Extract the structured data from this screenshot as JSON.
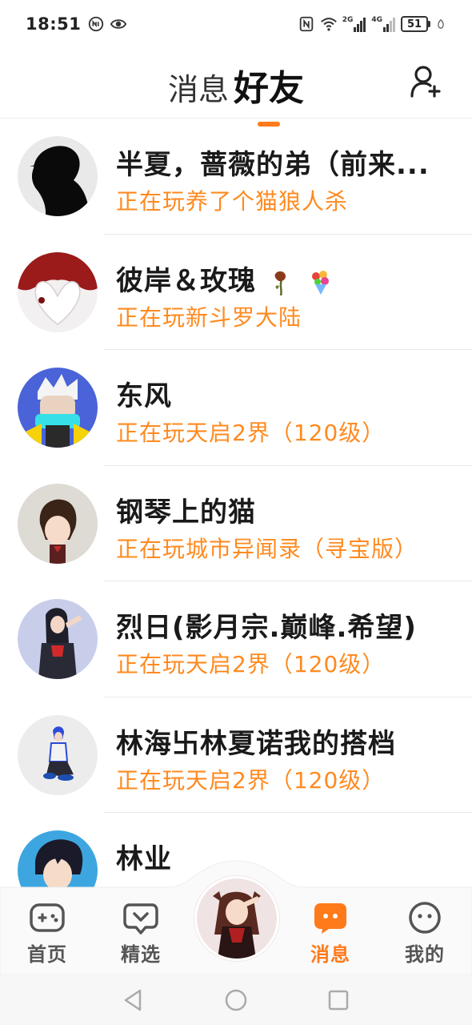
{
  "status_bar": {
    "time": "18:51",
    "network_2g": "2G",
    "network_4g": "4G",
    "battery": "51"
  },
  "header": {
    "tab_messages": "消息",
    "tab_friends": "好友",
    "active_tab": "好友"
  },
  "friends": [
    {
      "name": "半夏，蔷薇的弟（前来...",
      "status": "正在玩养了个猫狼人杀"
    },
    {
      "name": "彼岸＆玫瑰",
      "status": "正在玩新斗罗大陆"
    },
    {
      "name": "东风",
      "status": "正在玩天启2界（120级）"
    },
    {
      "name": "钢琴上的猫",
      "status": "正在玩城市异闻录（寻宝版）"
    },
    {
      "name": "烈日(影月宗.巅峰.希望)",
      "status": "正在玩天启2界（120级）"
    },
    {
      "name": "林海卐林夏诺我的搭档",
      "status": "正在玩天启2界（120级）"
    },
    {
      "name": "林业",
      "status": ""
    }
  ],
  "bottom_nav": {
    "home": "首页",
    "featured": "精选",
    "messages": "消息",
    "mine": "我的",
    "active": "消息"
  },
  "colors": {
    "accent": "#ff7a1a",
    "status_text": "#ff8a1f",
    "name_text": "#1a1a1a"
  },
  "icons": {
    "add_friend": "add-user-icon",
    "home": "gamepad-icon",
    "featured": "heart-chat-icon",
    "messages": "chat-bubble-icon",
    "mine": "face-icon"
  }
}
